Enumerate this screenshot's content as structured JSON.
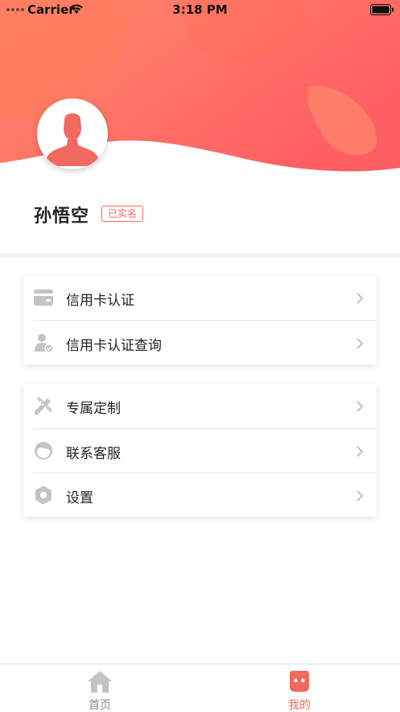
{
  "status_bar": {
    "carrier": "Carrier",
    "time": "3:18 PM"
  },
  "profile": {
    "name": "孙悟空",
    "badge": "已实名"
  },
  "menu_groups": [
    {
      "items": [
        {
          "label": "信用卡认证",
          "icon": "credit-card-icon"
        },
        {
          "label": "信用卡认证查询",
          "icon": "user-verified-icon"
        }
      ]
    },
    {
      "items": [
        {
          "label": "专属定制",
          "icon": "pencil-ruler-icon"
        },
        {
          "label": "联系客服",
          "icon": "customer-service-icon"
        },
        {
          "label": "设置",
          "icon": "settings-hexagon-icon"
        }
      ]
    }
  ],
  "tabbar": {
    "home_label": "首页",
    "mine_label": "我的"
  },
  "colors": {
    "accent": "#f06a5f",
    "header_gradient_start": "#ff8a6b",
    "header_gradient_end": "#ff5e62",
    "icon_gray": "#c4c4c4"
  }
}
